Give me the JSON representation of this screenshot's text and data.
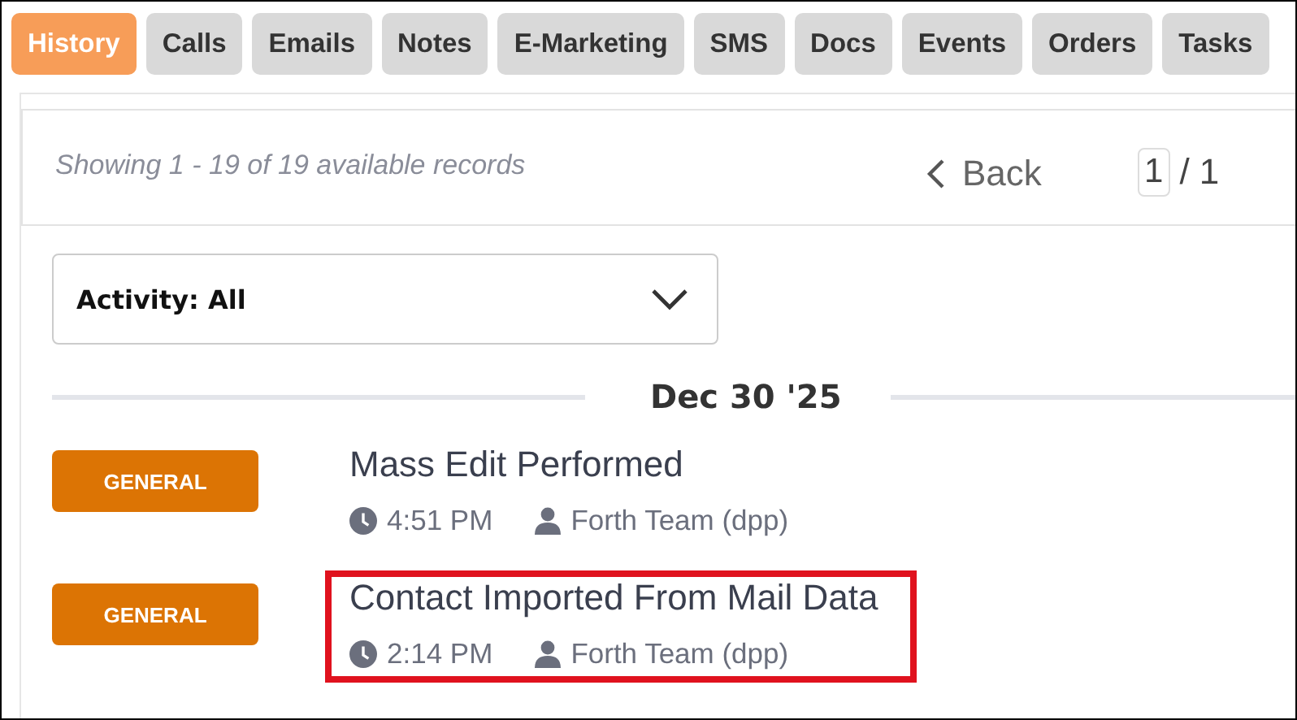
{
  "tabs": [
    {
      "label": "History",
      "selected": true
    },
    {
      "label": "Calls",
      "selected": false
    },
    {
      "label": "Emails",
      "selected": false
    },
    {
      "label": "Notes",
      "selected": false
    },
    {
      "label": "E-Marketing",
      "selected": false
    },
    {
      "label": "SMS",
      "selected": false
    },
    {
      "label": "Docs",
      "selected": false
    },
    {
      "label": "Events",
      "selected": false
    },
    {
      "label": "Orders",
      "selected": false
    },
    {
      "label": "Tasks",
      "selected": false
    }
  ],
  "records": {
    "summary": "Showing 1 - 19 of 19 available records",
    "back": "Back",
    "page": "1",
    "page_total": "/ 1"
  },
  "filter": {
    "value": "Activity: All"
  },
  "date_heading": "Dec 30 '25",
  "entries": [
    {
      "badge": "GENERAL",
      "title": "Mass Edit Performed",
      "time": "4:51 PM",
      "user": "Forth Team (dpp)",
      "highlighted": false
    },
    {
      "badge": "GENERAL",
      "title": "Contact Imported From Mail Data",
      "time": "2:14 PM",
      "user": "Forth Team (dpp)",
      "highlighted": true
    }
  ]
}
